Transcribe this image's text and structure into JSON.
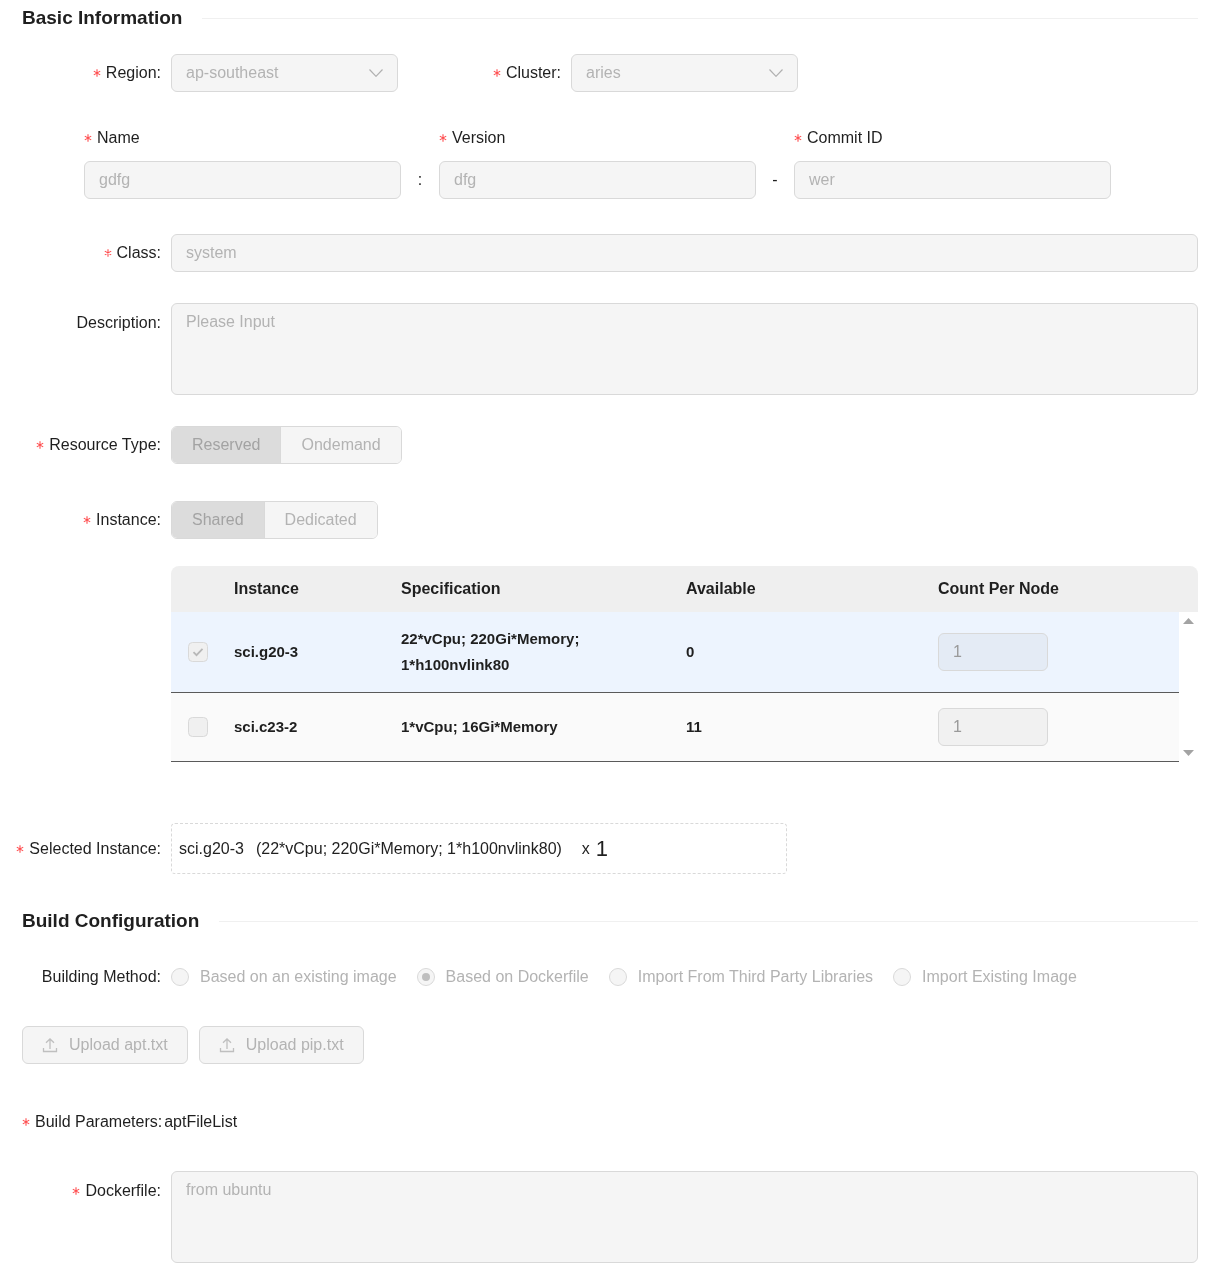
{
  "basic_information": {
    "title": "Basic Information",
    "region": {
      "label": "Region:",
      "required": true,
      "value": "ap-southeast",
      "disabled": true
    },
    "cluster": {
      "label": "Cluster:",
      "required": true,
      "value": "aries",
      "disabled": true
    },
    "image": {
      "fields": [
        {
          "label": "Name",
          "required": true,
          "value": "gdfg",
          "disabled": true
        },
        {
          "label": "Version",
          "required": true,
          "value": "dfg",
          "disabled": true
        },
        {
          "label": "Commit ID",
          "required": true,
          "value": "wer",
          "disabled": true
        }
      ],
      "separators": [
        ":",
        "-"
      ]
    },
    "class": {
      "label": "Class:",
      "required": true,
      "value": "system",
      "disabled": true
    },
    "description": {
      "label": "Description:",
      "required": false,
      "placeholder": "Please Input",
      "disabled": true
    },
    "resource_type": {
      "label": "Resource Type:",
      "required": true,
      "disabled": true,
      "options": [
        {
          "label": "Reserved",
          "selected": true
        },
        {
          "label": "Ondemand",
          "selected": false
        }
      ]
    },
    "instance": {
      "label": "Instance:",
      "required": true,
      "disabled": true,
      "options": [
        {
          "label": "Shared",
          "selected": true
        },
        {
          "label": "Dedicated",
          "selected": false
        }
      ]
    },
    "instance_table": {
      "columns": [
        "Instance",
        "Specification",
        "Available",
        "Count Per Node"
      ],
      "rows": [
        {
          "selected": true,
          "disabled": true,
          "instance": "sci.g20-3",
          "specification": "22*vCpu; 220Gi*Memory; 1*h100nvlink80",
          "available": "0",
          "count_per_node": "1"
        },
        {
          "selected": false,
          "disabled": true,
          "instance": "sci.c23-2",
          "specification": "1*vCpu; 16Gi*Memory",
          "available": "11",
          "count_per_node": "1"
        }
      ]
    },
    "selected_instance": {
      "label": "Selected Instance:",
      "required": true,
      "instance": "sci.g20-3",
      "specification": "(22*vCpu; 220Gi*Memory; 1*h100nvlink80)",
      "multiplier": "x",
      "count": "1"
    }
  },
  "build_configuration": {
    "title": "Build Configuration",
    "building_method": {
      "label": "Building Method:",
      "required": false,
      "disabled": true,
      "options": [
        {
          "label": "Based on an existing image",
          "selected": false
        },
        {
          "label": "Based on Dockerfile",
          "selected": true
        },
        {
          "label": "Import From Third Party Libraries",
          "selected": false
        },
        {
          "label": "Import Existing Image",
          "selected": false
        }
      ]
    },
    "upload_buttons": [
      {
        "label": "Upload apt.txt",
        "disabled": true
      },
      {
        "label": "Upload pip.txt",
        "disabled": true
      }
    ],
    "build_parameters": {
      "label": "Build Parameters:",
      "required": true,
      "value": "aptFileList"
    },
    "dockerfile": {
      "label": "Dockerfile:",
      "required": true,
      "value": "from ubuntu",
      "disabled": true
    }
  }
}
